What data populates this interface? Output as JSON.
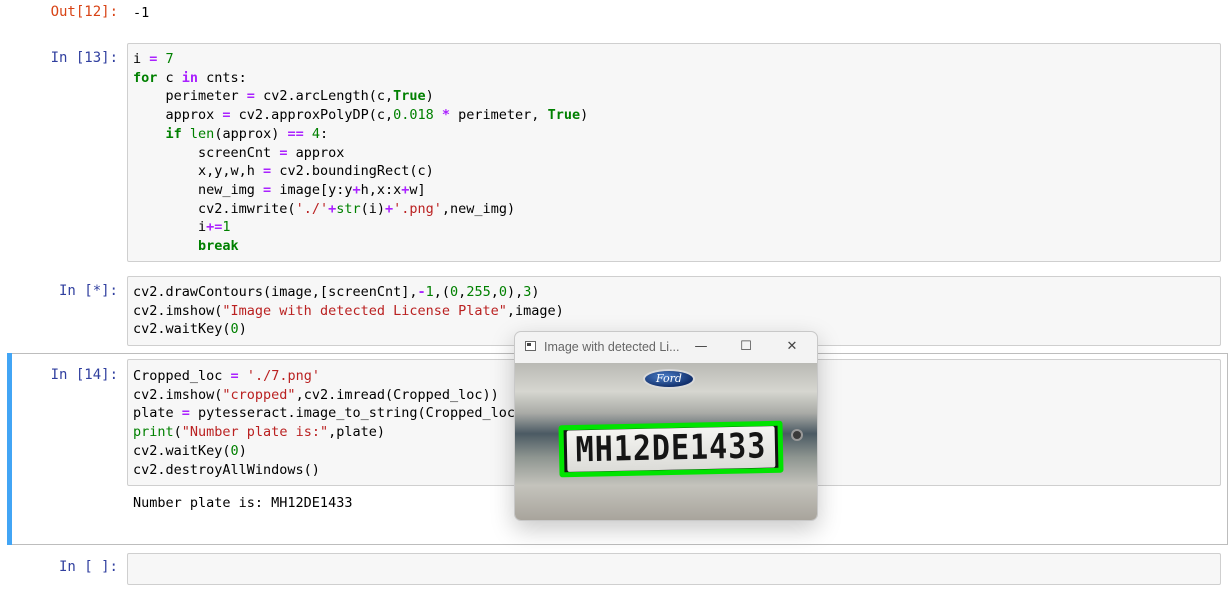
{
  "cells": {
    "out12": {
      "prompt": "Out[12]:",
      "text": "-1"
    },
    "in13": {
      "prompt": "In [13]:"
    },
    "in_star": {
      "prompt": "In [*]:"
    },
    "in14": {
      "prompt": "In [14]:",
      "output": "Number plate is: MH12DE1433"
    },
    "in_empty": {
      "prompt": "In [ ]:"
    }
  },
  "popup": {
    "title": "Image with detected Li...",
    "plate_text": "MH12DE1433",
    "logo_text": "Ford",
    "minimize": "—",
    "maximize": "☐",
    "close": "✕"
  },
  "colors": {
    "selection_bar": "#42a5f5",
    "contour": "#00e400",
    "prompt_in": "#303f9f",
    "prompt_out": "#d84315"
  }
}
